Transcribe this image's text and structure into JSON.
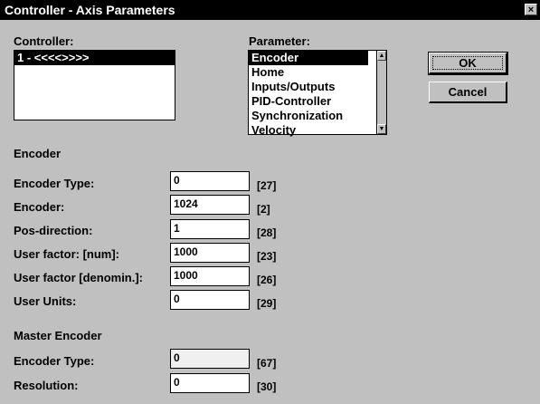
{
  "window": {
    "title": "Controller - Axis Parameters",
    "close_glyph": "×"
  },
  "controller": {
    "label": "Controller:",
    "items": [
      "1 - <<<<>>>>"
    ]
  },
  "parameter": {
    "label": "Parameter:",
    "items": [
      "Encoder",
      "Home",
      "Inputs/Outputs",
      "PID-Controller",
      "Synchronization",
      "Velocity"
    ]
  },
  "buttons": {
    "ok": "OK",
    "cancel": "Cancel"
  },
  "encoder": {
    "heading": "Encoder",
    "rows": [
      {
        "label": "Encoder Type:",
        "value": "0",
        "code": "[27]"
      },
      {
        "label": "Encoder:",
        "value": "1024",
        "code": "[2]"
      },
      {
        "label": "Pos-direction:",
        "value": "1",
        "code": "[28]"
      },
      {
        "label": "User factor: [num]:",
        "value": "1000",
        "code": "[23]"
      },
      {
        "label": "User factor [denomin.]:",
        "value": "1000",
        "code": "[26]"
      },
      {
        "label": "User Units:",
        "value": "0",
        "code": "[29]"
      }
    ]
  },
  "master_encoder": {
    "heading": "Master Encoder",
    "rows": [
      {
        "label": "Encoder Type:",
        "value": "0",
        "code": "[67]"
      },
      {
        "label": "Resolution:",
        "value": "0",
        "code": "[30]"
      }
    ]
  }
}
